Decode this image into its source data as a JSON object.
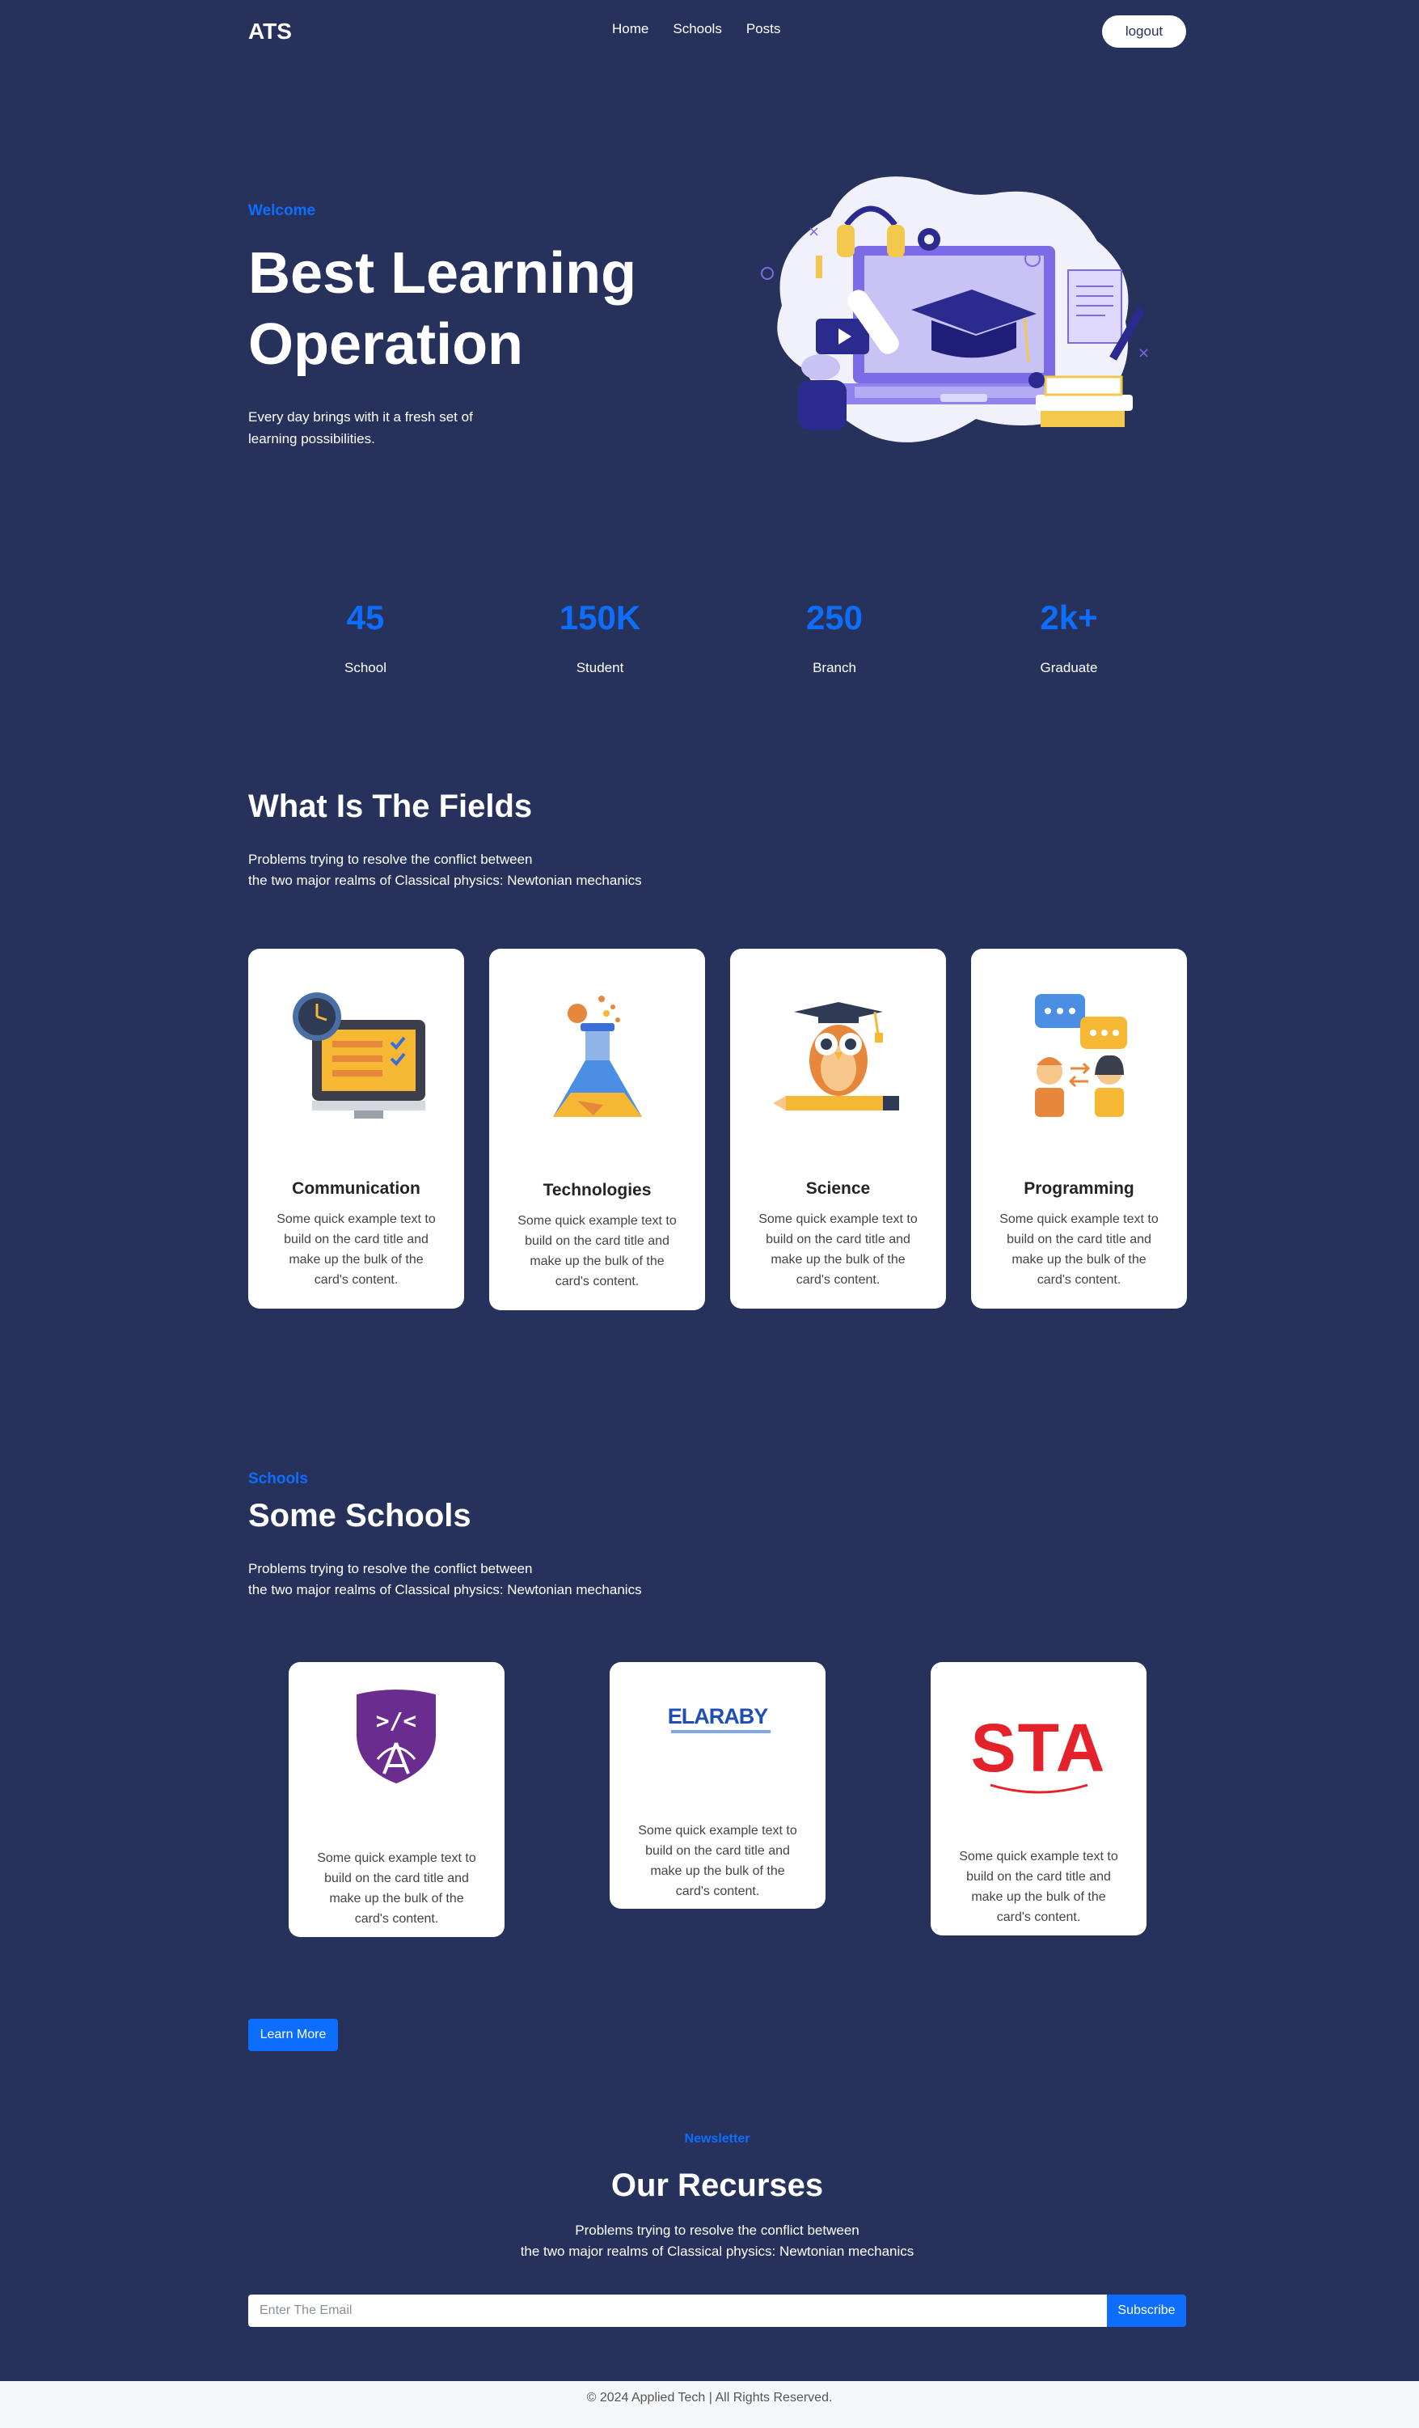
{
  "nav": {
    "brand": "ATS",
    "links": [
      "Home",
      "Schools",
      "Posts"
    ],
    "logout_label": "logout"
  },
  "hero": {
    "eyebrow": "Welcome",
    "title": "Best Learning Operation",
    "description": "Every day brings with it a fresh set of learning possibilities."
  },
  "stats": [
    {
      "value": "45",
      "label": "School"
    },
    {
      "value": "150K",
      "label": "Student"
    },
    {
      "value": "250",
      "label": "Branch"
    },
    {
      "value": "2k+",
      "label": "Graduate"
    }
  ],
  "fields": {
    "title": "What Is The Fields",
    "description_line1": "Problems trying to resolve the conflict between",
    "description_line2": "the two major realms of Classical physics: Newtonian mechanics",
    "cards": [
      {
        "title": "Communication",
        "text": "Some quick example text to build on the card title and make up the bulk of the card's content.",
        "icon": "monitor-checklist-icon"
      },
      {
        "title": "Technologies",
        "text": "Some quick example text to build on the card title and make up the bulk of the card's content.",
        "icon": "flask-icon"
      },
      {
        "title": "Science",
        "text": "Some quick example text to build on the card title and make up the bulk of the card's content.",
        "icon": "owl-graduate-icon"
      },
      {
        "title": "Programming",
        "text": "Some quick example text to build on the card title and make up the bulk of the card's content.",
        "icon": "people-chat-icon"
      }
    ]
  },
  "schools": {
    "eyebrow": "Schools",
    "title": "Some Schools",
    "description_line1": "Problems trying to resolve the conflict between",
    "description_line2": "the two major realms of Classical physics: Newtonian mechanics",
    "cards": [
      {
        "logo": "code-shield-logo",
        "text": "Some quick example text to build on the card title and make up the bulk of the card's content."
      },
      {
        "logo": "elaraby-logo",
        "logo_text": "ELARABY",
        "text": "Some quick example text to build on the card title and make up the bulk of the card's content."
      },
      {
        "logo": "sta-logo",
        "logo_text": "STA",
        "text": "Some quick example text to build on the card title and make up the bulk of the card's content."
      }
    ],
    "learn_more_label": "Learn More"
  },
  "newsletter": {
    "eyebrow": "Newsletter",
    "title": "Our Recurses",
    "description_line1": "Problems trying to resolve the conflict between",
    "description_line2": "the two major realms of Classical physics: Newtonian mechanics",
    "email_placeholder": "Enter The Email",
    "subscribe_label": "Subscribe"
  },
  "footer": {
    "text": "© 2024 Applied Tech | All Rights Reserved."
  },
  "colors": {
    "background": "#27325c",
    "accent": "#0d6efd",
    "card": "#ffffff",
    "footer": "#f6f7f9"
  }
}
